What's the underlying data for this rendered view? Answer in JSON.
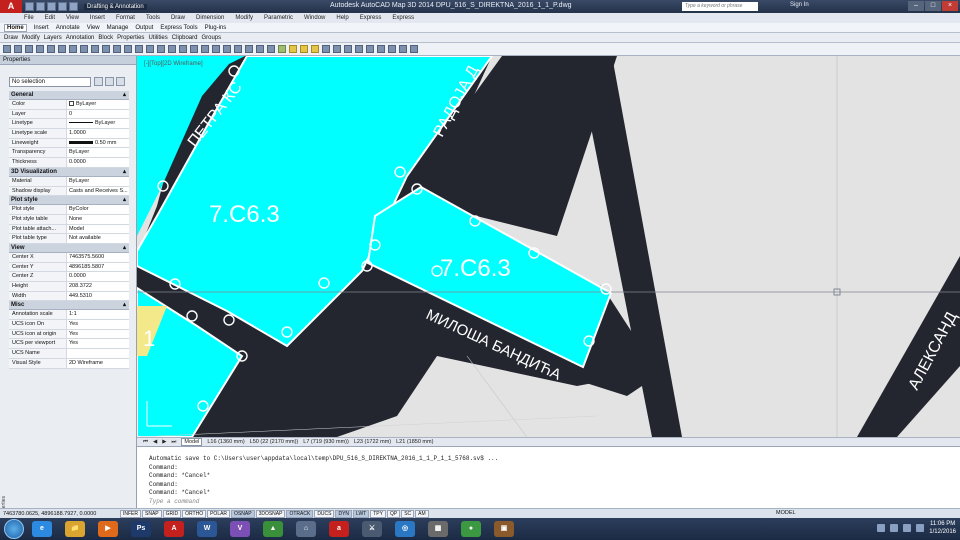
{
  "window": {
    "title": "Autodesk AutoCAD Map 3D 2014   DPU_516_S_DIREKTNA_2016_1_1_P.dwg",
    "workspace": "Drafting & Annotation",
    "search_placeholder": "Type a keyword or phrase",
    "sign_in": "Sign In",
    "min": "–",
    "max": "□",
    "close": "×"
  },
  "menu": [
    "File",
    "Edit",
    "View",
    "Insert",
    "Format",
    "Tools",
    "Draw",
    "Dimension",
    "Modify",
    "Parametric",
    "Window",
    "Help",
    "Express",
    "Express"
  ],
  "ribbon_tabs": [
    "Home",
    "Insert",
    "Annotate",
    "View",
    "Manage",
    "Output",
    "Express Tools",
    "Plug-ins"
  ],
  "ribbon_active": "Home",
  "ribbon_panels": [
    "Draw",
    "Modify",
    "Layers",
    "Annotation",
    "Block",
    "Properties",
    "Utilities",
    "Clipboard",
    "Groups"
  ],
  "properties": {
    "title": "Properties",
    "selection": "No selection",
    "sections": {
      "general": "General",
      "visualization": "3D Visualization",
      "plotstyle": "Plot style",
      "view": "View",
      "misc": "Misc"
    },
    "general": [
      {
        "k": "Color",
        "v": "ByLayer"
      },
      {
        "k": "Layer",
        "v": "0"
      },
      {
        "k": "Linetype",
        "v": "ByLayer"
      },
      {
        "k": "Linetype scale",
        "v": "1.0000"
      },
      {
        "k": "Lineweight",
        "v": "0.50 mm"
      },
      {
        "k": "Transparency",
        "v": "ByLayer"
      },
      {
        "k": "Thickness",
        "v": "0.0000"
      }
    ],
    "visualization": [
      {
        "k": "Material",
        "v": "ByLayer"
      },
      {
        "k": "Shadow display",
        "v": "Casts and Receives S..."
      }
    ],
    "plotstyle": [
      {
        "k": "Plot style",
        "v": "ByColor"
      },
      {
        "k": "Plot style table",
        "v": "None"
      },
      {
        "k": "Plot table attach...",
        "v": "Model"
      },
      {
        "k": "Plot table type",
        "v": "Not available"
      }
    ],
    "view": [
      {
        "k": "Center X",
        "v": "7463575.5600"
      },
      {
        "k": "Center Y",
        "v": "4896185.5807"
      },
      {
        "k": "Center Z",
        "v": "0.0000"
      },
      {
        "k": "Height",
        "v": "208.3722"
      },
      {
        "k": "Width",
        "v": "449.5310"
      }
    ],
    "misc": [
      {
        "k": "Annotation scale",
        "v": "1:1"
      },
      {
        "k": "UCS icon On",
        "v": "Yes"
      },
      {
        "k": "UCS icon at origin",
        "v": "Yes"
      },
      {
        "k": "UCS per viewport",
        "v": "Yes"
      },
      {
        "k": "UCS Name",
        "v": ""
      },
      {
        "k": "Visual Style",
        "v": "2D Wireframe"
      }
    ]
  },
  "viewport": {
    "label": "[-][Top][2D Wireframe]",
    "parcel_label_1": "7.C6.3",
    "parcel_label_2": "7.C6.3",
    "street_1": "ПЕТРА КС",
    "street_2": "РАДОЈА Д",
    "street_3": "МИЛОША БАНДИЋА",
    "street_4": "АЛЕКСАНД",
    "parcel_number": "1"
  },
  "layout_tabs": [
    "Model",
    "L16 (1360 mm)",
    "L50 (22 (2170 mm))",
    "L7 (719 (930 mm))",
    "L23 (1722 mm)",
    "L21 (1850 mm)"
  ],
  "layout_active": "Model",
  "command_lines": [
    "Automatic save to C:\\Users\\user\\appdata\\local\\temp\\DPU_516_S_DIREKTNA_2016_1_1_P_1_1_5768.sv$ ...",
    "Command:",
    "Command: *Cancel*",
    "Command:",
    "Command: *Cancel*"
  ],
  "command_prompt": "Type a command",
  "status": {
    "coords": "7463780.0625, 4896188.7927, 0.0000",
    "toggles": [
      "INFER",
      "SNAP",
      "GRID",
      "ORTHO",
      "POLAR",
      "OSNAP",
      "3DOSNAP",
      "OTRACK",
      "DUCS",
      "DYN",
      "LWT",
      "TPY",
      "QP",
      "SC",
      "AM"
    ],
    "model": "MODEL"
  },
  "taskbar": {
    "apps": [
      "e",
      "📁",
      "▶",
      "Ps",
      "A",
      "W",
      "V",
      "▲",
      "⌂",
      "a",
      "⚔",
      "◎",
      "▦",
      "●",
      "▣"
    ],
    "time": "11:06 PM",
    "date": "1/12/2016"
  },
  "colors": {
    "parcel": "#00ffff",
    "road": "#23262f",
    "background": "#e3e3e3"
  }
}
